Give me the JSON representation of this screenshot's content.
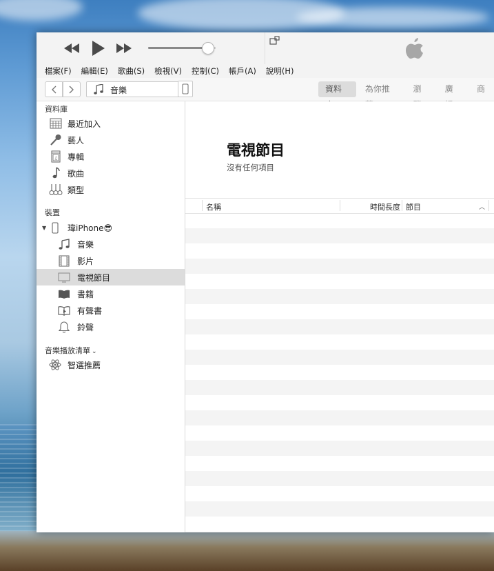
{
  "window": {
    "menu": [
      "檔案(F)",
      "編輯(E)",
      "歌曲(S)",
      "檢視(V)",
      "控制(C)",
      "帳戶(A)",
      "說明(H)"
    ],
    "media_kind": "音樂",
    "tabs": [
      {
        "label": "資料庫",
        "active": true
      },
      {
        "label": "為你推薦",
        "active": false
      },
      {
        "label": "瀏覽",
        "active": false
      },
      {
        "label": "廣播",
        "active": false
      },
      {
        "label": "商",
        "active": false
      }
    ]
  },
  "sidebar": {
    "library_title": "資料庫",
    "library_items": [
      {
        "label": "最近加入",
        "icon": "calendar-grid-icon"
      },
      {
        "label": "藝人",
        "icon": "microphone-icon"
      },
      {
        "label": "專輯",
        "icon": "album-icon"
      },
      {
        "label": "歌曲",
        "icon": "music-note-icon"
      },
      {
        "label": "類型",
        "icon": "guitars-icon"
      }
    ],
    "devices_title": "裝置",
    "device": {
      "name": "瑋iPhone😎",
      "icon": "iphone-icon"
    },
    "device_items": [
      {
        "label": "音樂",
        "icon": "music-notes-icon"
      },
      {
        "label": "影片",
        "icon": "film-icon"
      },
      {
        "label": "電視節目",
        "icon": "tv-icon",
        "selected": true
      },
      {
        "label": "書籍",
        "icon": "book-icon"
      },
      {
        "label": "有聲書",
        "icon": "audiobook-icon"
      },
      {
        "label": "鈴聲",
        "icon": "bell-icon"
      }
    ],
    "playlists_title": "音樂播放清單",
    "playlist_items": [
      {
        "label": "智選推薦",
        "icon": "genius-atom-icon"
      }
    ]
  },
  "main": {
    "title": "電視節目",
    "subtitle": "沒有任何項目",
    "columns": {
      "name": "名稱",
      "duration": "時間長度",
      "show": "節目"
    }
  },
  "volume": {
    "level": 0.88
  }
}
